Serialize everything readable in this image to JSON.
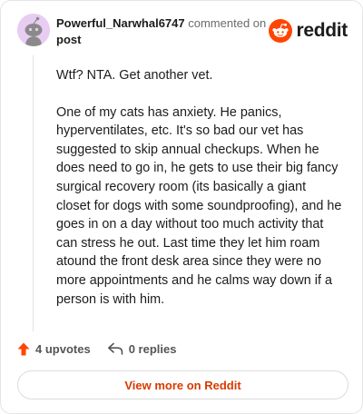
{
  "comment": {
    "username": "Powerful_Narwhal6747",
    "action_text": "commented on",
    "post_link": "post",
    "paragraphs": [
      "Wtf? NTA. Get another vet.",
      "One of my cats has anxiety. He panics, hyperventilates, etc. It's so bad our vet has suggested to skip annual checkups. When he does need to go in, he gets to use their big fancy surgical recovery room (its basically a giant closet for dogs with some soundproofing), and he goes in on a day without too much activity that can stress he out. Last time they let him roam atound the front desk area since they were no more appointments and he calms way down if a person is with him."
    ],
    "upvotes": "4 upvotes",
    "replies": "0 replies"
  },
  "brand": {
    "name": "reddit",
    "color": "#ff4500"
  },
  "footer": {
    "view_label": "View more on Reddit"
  },
  "colors": {
    "upvote": "#ff4500",
    "link": "#d93a00",
    "avatar_bg": "#e8cdf2"
  },
  "icons": [
    "avatar-snoo-icon",
    "reddit-logo-icon",
    "upvote-arrow-icon",
    "reply-arrow-icon"
  ]
}
